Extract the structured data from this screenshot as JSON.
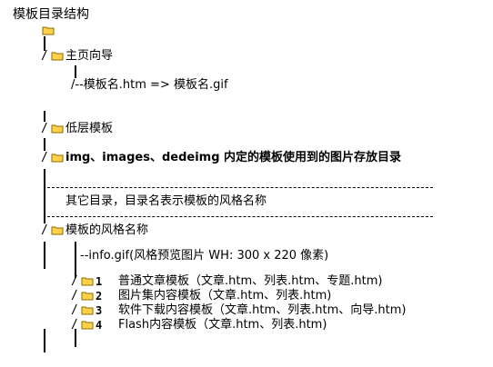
{
  "root": {
    "title": "模板目录结构"
  },
  "tree": {
    "main_guide": {
      "label": "主页向导",
      "connector": "/",
      "child": "/--模板名.htm => 模板名.gif"
    },
    "low_layer": {
      "label": "低层模板",
      "connector": "/"
    },
    "img_dirs": {
      "label": "img、images、dedeimg 内定的模板使用到的图片存放目录",
      "connector": "/"
    },
    "separator_text": "其它目录，目录名表示模板的风格名称",
    "style": {
      "label": "模板的风格名称",
      "connector": "/",
      "info": "--info.gif(风格预览图片 WH: 300 x 220 像素)",
      "items": [
        {
          "num": "1",
          "text": "普通文章模板（文章.htm、列表.htm、专题.htm)"
        },
        {
          "num": "2",
          "text": "图片集内容模板（文章.htm、列表.htm)"
        },
        {
          "num": "3",
          "text": "软件下载内容模板（文章.htm、列表.htm、向导.htm)"
        },
        {
          "num": "4",
          "text": "Flash内容模板（文章.htm、列表.htm)"
        }
      ]
    }
  },
  "colors": {
    "folder_fill": "#ffd24a",
    "folder_stroke": "#8a6a00",
    "text": "#000000"
  },
  "icons": {
    "folder": "folder-icon"
  }
}
